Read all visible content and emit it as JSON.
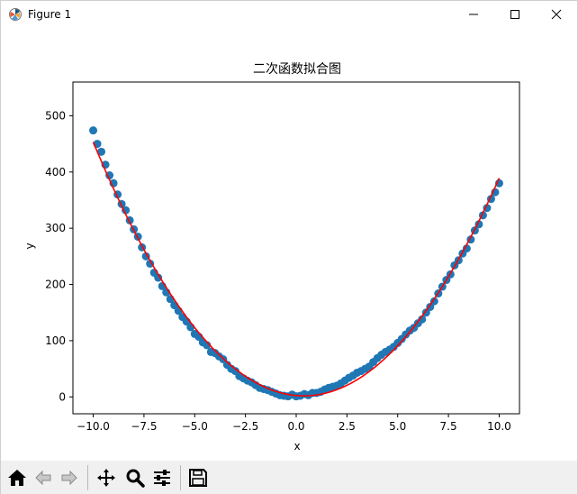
{
  "window": {
    "title": "Figure 1"
  },
  "chart_data": {
    "type": "scatter",
    "title": "二次函数拟合图",
    "xlabel": "x",
    "ylabel": "y",
    "xlim": [
      -11.0,
      11.0
    ],
    "ylim": [
      -30,
      560
    ],
    "xticks": [
      -10.0,
      -7.5,
      -5.0,
      -2.5,
      0.0,
      2.5,
      5.0,
      7.5,
      10.0
    ],
    "xtick_labels": [
      "−10.0",
      "−7.5",
      "−5.0",
      "−2.5",
      "0.0",
      "2.5",
      "5.0",
      "7.5",
      "10.0"
    ],
    "yticks": [
      0,
      100,
      200,
      300,
      400,
      500
    ],
    "ytick_labels": [
      "0",
      "100",
      "200",
      "300",
      "400",
      "500"
    ],
    "grid": false,
    "series": [
      {
        "kind": "scatter",
        "color": "#1f77b4",
        "x": [
          -10.0,
          -9.8,
          -9.6,
          -9.4,
          -9.2,
          -9.0,
          -8.8,
          -8.6,
          -8.4,
          -8.2,
          -8.0,
          -7.8,
          -7.6,
          -7.4,
          -7.2,
          -7.0,
          -6.8,
          -6.6,
          -6.4,
          -6.2,
          -6.0,
          -5.8,
          -5.6,
          -5.4,
          -5.2,
          -5.0,
          -4.8,
          -4.6,
          -4.4,
          -4.2,
          -4.0,
          -3.8,
          -3.6,
          -3.4,
          -3.2,
          -3.0,
          -2.8,
          -2.6,
          -2.4,
          -2.2,
          -2.0,
          -1.8,
          -1.6,
          -1.4,
          -1.2,
          -1.0,
          -0.8,
          -0.6,
          -0.4,
          -0.2,
          0.0,
          0.2,
          0.4,
          0.6,
          0.8,
          1.0,
          1.2,
          1.4,
          1.6,
          1.8,
          2.0,
          2.2,
          2.4,
          2.6,
          2.8,
          3.0,
          3.2,
          3.4,
          3.6,
          3.8,
          4.0,
          4.2,
          4.4,
          4.6,
          4.8,
          5.0,
          5.2,
          5.4,
          5.6,
          5.8,
          6.0,
          6.2,
          6.4,
          6.6,
          6.8,
          7.0,
          7.2,
          7.4,
          7.6,
          7.8,
          8.0,
          8.2,
          8.4,
          8.6,
          8.8,
          9.0,
          9.2,
          9.4,
          9.6,
          9.8,
          10.0
        ],
        "y": [
          474,
          450,
          436,
          413,
          394,
          380,
          360,
          343,
          332,
          314,
          298,
          285,
          266,
          250,
          237,
          221,
          212,
          197,
          186,
          174,
          163,
          153,
          142,
          134,
          124,
          112,
          107,
          97,
          92,
          80,
          78,
          72,
          67,
          57,
          50,
          46,
          37,
          33,
          29,
          26,
          21,
          16,
          14,
          12,
          9,
          6,
          3,
          2,
          1,
          4,
          1,
          2,
          5,
          3,
          7,
          7,
          9,
          13,
          16,
          18,
          20,
          24,
          29,
          34,
          38,
          43,
          46,
          50,
          54,
          62,
          69,
          75,
          80,
          84,
          89,
          96,
          103,
          111,
          118,
          123,
          131,
          138,
          150,
          160,
          170,
          184,
          196,
          208,
          218,
          234,
          243,
          255,
          264,
          280,
          296,
          307,
          323,
          336,
          352,
          364,
          380
        ]
      },
      {
        "kind": "line",
        "color": "#ff0000",
        "note": "fit"
      }
    ]
  },
  "toolbar": {
    "home_icon": "home-icon",
    "back_icon": "back-arrow-icon",
    "forward_icon": "forward-arrow-icon",
    "pan_icon": "pan-move-icon",
    "zoom_icon": "zoom-magnifier-icon",
    "configure_icon": "configure-subplots-icon",
    "save_icon": "save-floppy-icon"
  }
}
